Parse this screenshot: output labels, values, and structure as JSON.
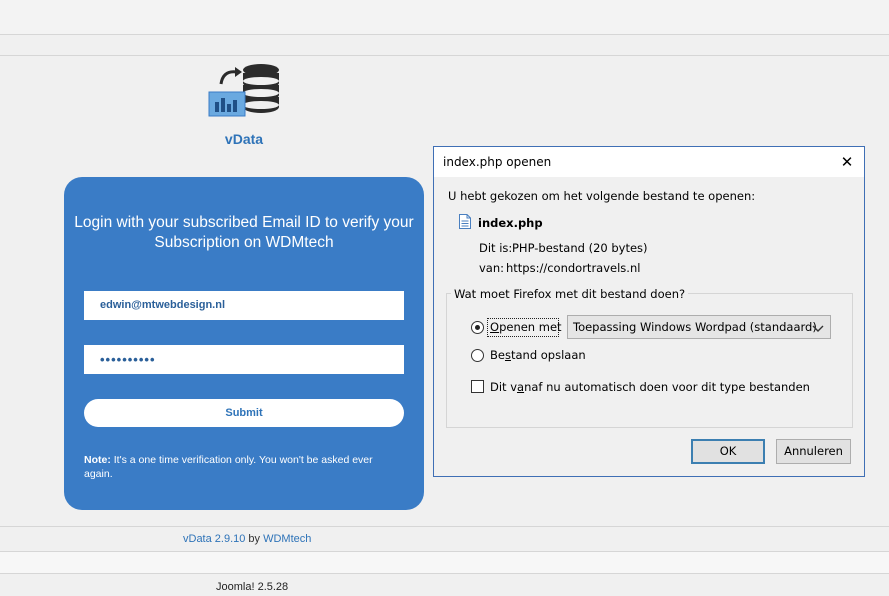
{
  "page": {
    "brand": "vData",
    "login": {
      "title": "Login with your subscribed Email ID to verify your Subscription on WDMtech",
      "email_value": "edwin@mtwebdesign.nl",
      "password_mask": "••••••••••",
      "submit_label": "Submit",
      "note_label": "Note:",
      "note_text": " It's a one time verification only. You won't be asked ever again."
    },
    "footer": {
      "version": "vData 2.9.10",
      "by": " by ",
      "author_link": "WDMtech",
      "joomla": "Joomla! 2.5.28"
    }
  },
  "dialog": {
    "title": "index.php openen",
    "close_glyph": "✕",
    "intro": "U hebt gekozen om het volgende bestand te openen:",
    "file_name": "index.php",
    "type_label": "Dit is:",
    "type_value": "PHP-bestand (20 bytes)",
    "from_label": "van:",
    "from_value": "https://condortravels.nl",
    "question": "Wat moet Firefox met dit bestand doen?",
    "open_with_label": "Openen met",
    "open_with_accel": "O",
    "open_with_rest": "penen met",
    "open_with_app": "Toepassing Windows Wordpad (standaard)",
    "save_label_pre": "Be",
    "save_label_accel": "s",
    "save_label_post": "tand opslaan",
    "auto_label_pre": "Dit v",
    "auto_label_accel": "a",
    "auto_label_post": "naf nu automatisch doen voor dit type bestanden",
    "selected_option": "open_with",
    "auto_checked": false,
    "ok_label": "OK",
    "cancel_label": "Annuleren"
  },
  "colors": {
    "accent": "#3a7cc6",
    "link": "#2e73b8",
    "dialog_border": "#3f6fb5"
  },
  "icons": {
    "logo": "vdata-database-chart-icon",
    "file": "document-file-icon",
    "close": "close-icon",
    "dropdown": "chevron-down-icon"
  }
}
